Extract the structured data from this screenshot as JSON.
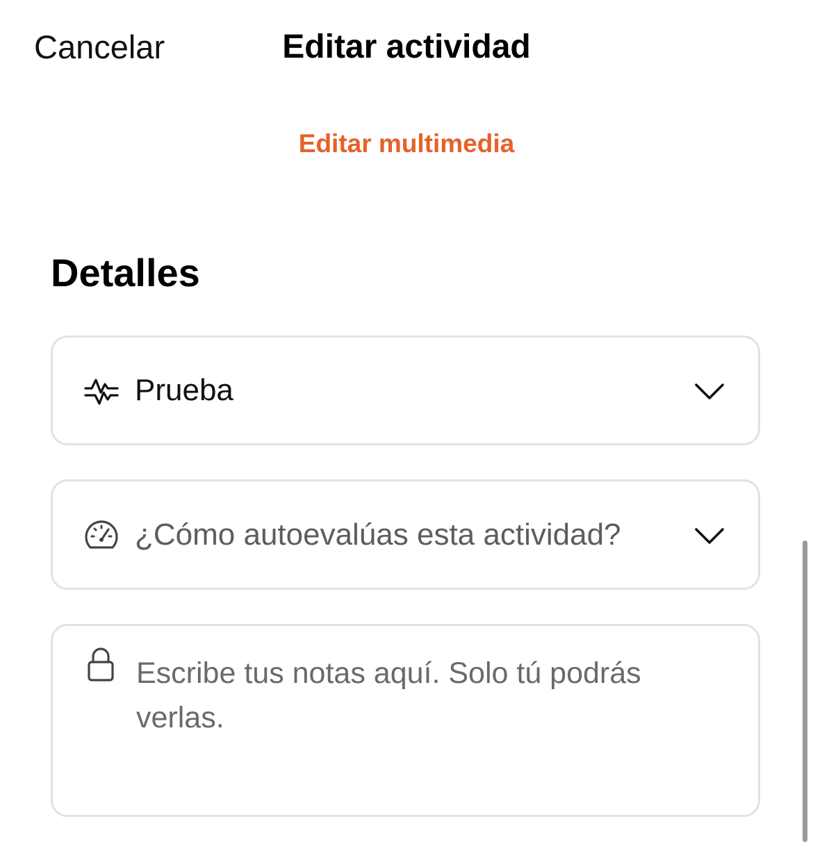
{
  "nav": {
    "cancel_label": "Cancelar",
    "title": "Editar actividad"
  },
  "media": {
    "edit_label": "Editar multimedia"
  },
  "details": {
    "section_title": "Detalles",
    "activity_type": {
      "value": "Prueba",
      "icon": "activity-pulse-icon"
    },
    "perceived_exertion": {
      "placeholder": "¿Cómo autoevalúas esta actividad?",
      "icon": "speedometer-icon"
    },
    "private_notes": {
      "placeholder": "Escribe tus notas aquí. Solo tú podrás verlas.",
      "icon": "lock-icon"
    }
  },
  "colors": {
    "accent": "#e5622a",
    "border": "#e2e2e2",
    "placeholder": "#6a6a6a"
  }
}
